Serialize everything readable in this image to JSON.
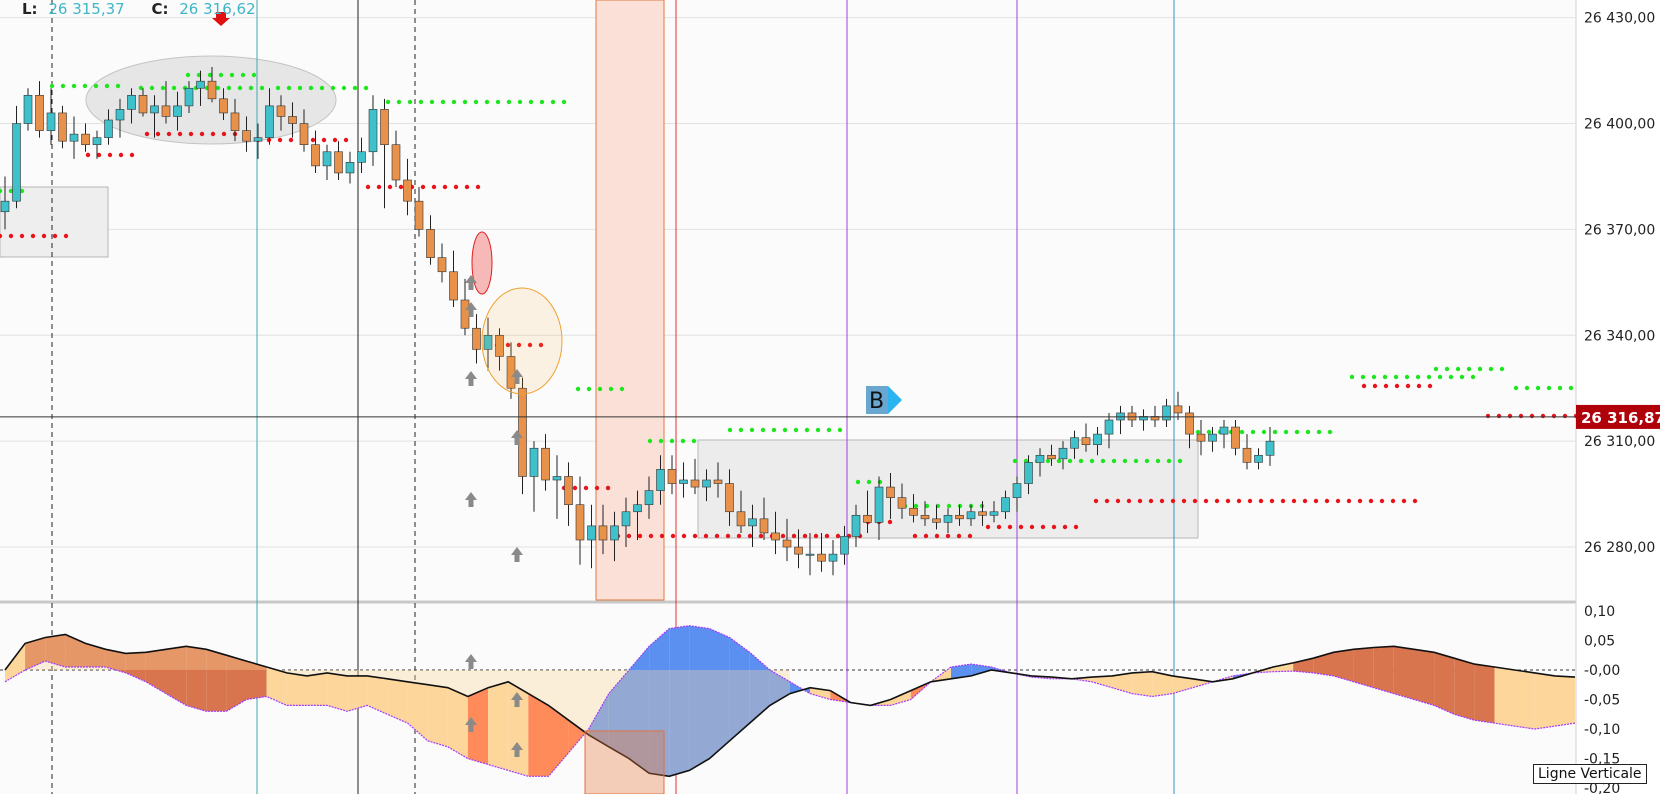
{
  "header": {
    "low_label": "L:",
    "low_value": "26 315,37",
    "close_label": "C:",
    "close_value": "26 316,62"
  },
  "price_axis": {
    "ticks": [
      "26 430,00",
      "26 400,00",
      "26 370,00",
      "26 340,00",
      "26 310,00",
      "26 280,00"
    ],
    "current_price": "26 316,87"
  },
  "oscillator_axis": {
    "ticks": [
      "0,10",
      "0,05",
      "-0,00",
      "-0,05",
      "-0,10",
      "-0,15",
      "-0,20"
    ]
  },
  "marker_label": "B",
  "vertical_line_label": "Ligne Verticale",
  "colors": {
    "bull_body": "#3fc1cc",
    "bear_body": "#e8914a",
    "support_dots": "#e8141a",
    "resistance_dots": "#1ee61e",
    "price_tag": "#b0000a",
    "osc_up_fill": "#d9754e",
    "osc_down_fill": "#ff8a5a",
    "osc_neutral_fill": "#fcd69a",
    "osc_blue_fill": "#5b8ff0"
  },
  "chart_data": [
    {
      "type": "candlestick",
      "ylim": [
        26265,
        26435
      ],
      "candles": [
        [
          26375,
          26385,
          26370,
          26378
        ],
        [
          26378,
          26405,
          26376,
          26400
        ],
        [
          26400,
          26410,
          26398,
          26408
        ],
        [
          26408,
          26412,
          26396,
          26398
        ],
        [
          26398,
          26410,
          26394,
          26403
        ],
        [
          26403,
          26405,
          26393,
          26395
        ],
        [
          26395,
          26402,
          26390,
          26397
        ],
        [
          26397,
          26400,
          26392,
          26394
        ],
        [
          26394,
          26398,
          26390,
          26396
        ],
        [
          26396,
          26404,
          26394,
          26401
        ],
        [
          26401,
          26407,
          26396,
          26404
        ],
        [
          26404,
          26410,
          26400,
          26408
        ],
        [
          26408,
          26410,
          26402,
          26403
        ],
        [
          26403,
          26408,
          26396,
          26405
        ],
        [
          26405,
          26412,
          26400,
          26402
        ],
        [
          26402,
          26409,
          26398,
          26405
        ],
        [
          26405,
          26412,
          26403,
          26410
        ],
        [
          26410,
          26415,
          26405,
          26412
        ],
        [
          26412,
          26416,
          26406,
          26407
        ],
        [
          26407,
          26410,
          26401,
          26403
        ],
        [
          26403,
          26407,
          26395,
          26398
        ],
        [
          26398,
          26402,
          26392,
          26395
        ],
        [
          26395,
          26400,
          26390,
          26396
        ],
        [
          26396,
          26410,
          26394,
          26405
        ],
        [
          26405,
          26408,
          26398,
          26402
        ],
        [
          26402,
          26406,
          26396,
          26400
        ],
        [
          26400,
          26404,
          26392,
          26394
        ],
        [
          26394,
          26398,
          26386,
          26388
        ],
        [
          26388,
          26394,
          26384,
          26392
        ],
        [
          26392,
          26395,
          26384,
          26386
        ],
        [
          26386,
          26392,
          26383,
          26389
        ],
        [
          26389,
          26396,
          26386,
          26392
        ],
        [
          26392,
          26408,
          26388,
          26404
        ],
        [
          26404,
          26407,
          26376,
          26394
        ],
        [
          26394,
          26398,
          26382,
          26384
        ],
        [
          26384,
          26390,
          26374,
          26378
        ],
        [
          26378,
          26382,
          26368,
          26370
        ],
        [
          26370,
          26374,
          26360,
          26362
        ],
        [
          26362,
          26366,
          26355,
          26358
        ],
        [
          26358,
          26364,
          26348,
          26350
        ],
        [
          26350,
          26356,
          26340,
          26342
        ],
        [
          26342,
          26346,
          26332,
          26336
        ],
        [
          26336,
          26345,
          26330,
          26340
        ],
        [
          26340,
          26342,
          26330,
          26334
        ],
        [
          26334,
          26338,
          26322,
          26325
        ],
        [
          26325,
          26328,
          26295,
          26300
        ],
        [
          26300,
          26310,
          26290,
          26308
        ],
        [
          26308,
          26312,
          26296,
          26299
        ],
        [
          26299,
          26306,
          26288,
          26300
        ],
        [
          26300,
          26304,
          26286,
          26292
        ],
        [
          26292,
          26300,
          26275,
          26282
        ],
        [
          26282,
          26292,
          26274,
          26286
        ],
        [
          26286,
          26292,
          26278,
          26282
        ],
        [
          26282,
          26290,
          26276,
          26286
        ],
        [
          26286,
          26294,
          26280,
          26290
        ],
        [
          26290,
          26296,
          26282,
          26292
        ],
        [
          26292,
          26300,
          26288,
          26296
        ],
        [
          26296,
          26306,
          26292,
          26302
        ],
        [
          26302,
          26306,
          26295,
          26298
        ],
        [
          26298,
          26304,
          26294,
          26299
        ],
        [
          26299,
          26305,
          26295,
          26297
        ],
        [
          26297,
          26302,
          26293,
          26299
        ],
        [
          26299,
          26304,
          26294,
          26298
        ],
        [
          26298,
          26302,
          26286,
          26290
        ],
        [
          26290,
          26296,
          26284,
          26286
        ],
        [
          26286,
          26292,
          26280,
          26288
        ],
        [
          26288,
          26294,
          26282,
          26284
        ],
        [
          26284,
          26290,
          26278,
          26282
        ],
        [
          26282,
          26288,
          26276,
          26280
        ],
        [
          26280,
          26285,
          26274,
          26278
        ],
        [
          26278,
          26284,
          26272,
          26278
        ],
        [
          26278,
          26284,
          26273,
          26276
        ],
        [
          26276,
          26282,
          26272,
          26278
        ],
        [
          26278,
          26286,
          26275,
          26283
        ],
        [
          26283,
          26292,
          26280,
          26289
        ],
        [
          26289,
          26296,
          26284,
          26287
        ],
        [
          26287,
          26300,
          26282,
          26297
        ],
        [
          26297,
          26301,
          26288,
          26294
        ],
        [
          26294,
          26298,
          26288,
          26291
        ],
        [
          26291,
          26295,
          26287,
          26289
        ],
        [
          26289,
          26293,
          26286,
          26288
        ],
        [
          26288,
          26292,
          26285,
          26287
        ],
        [
          26287,
          26291,
          26284,
          26289
        ],
        [
          26289,
          26292,
          26286,
          26288
        ],
        [
          26288,
          26292,
          26286,
          26290
        ],
        [
          26290,
          26293,
          26286,
          26289
        ],
        [
          26289,
          26293,
          26287,
          26290
        ],
        [
          26290,
          26296,
          26288,
          26294
        ],
        [
          26294,
          26300,
          26290,
          26298
        ],
        [
          26298,
          26306,
          26295,
          26304
        ],
        [
          26304,
          26308,
          26300,
          26306
        ],
        [
          26306,
          26309,
          26303,
          26305
        ],
        [
          26305,
          26310,
          26302,
          26308
        ],
        [
          26308,
          26313,
          26305,
          26311
        ],
        [
          26311,
          26315,
          26307,
          26309
        ],
        [
          26309,
          26314,
          26306,
          26312
        ],
        [
          26312,
          26318,
          26308,
          26316
        ],
        [
          26316,
          26320,
          26312,
          26318
        ],
        [
          26318,
          26320,
          26314,
          26316
        ],
        [
          26316,
          26319,
          26313,
          26317
        ],
        [
          26317,
          26320,
          26314,
          26316
        ],
        [
          26316,
          26322,
          26314,
          26320
        ],
        [
          26320,
          26324,
          26316,
          26318
        ],
        [
          26318,
          26320,
          26308,
          26312
        ],
        [
          26312,
          26316,
          26306,
          26310
        ],
        [
          26310,
          26314,
          26307,
          26312
        ],
        [
          26312,
          26316,
          26308,
          26314
        ],
        [
          26314,
          26316,
          26306,
          26308
        ],
        [
          26308,
          26312,
          26302,
          26304
        ],
        [
          26304,
          26308,
          26302,
          26306
        ],
        [
          26306,
          26314,
          26303,
          26310
        ]
      ]
    },
    {
      "type": "area",
      "ylim": [
        -0.21,
        0.11
      ],
      "series": [
        {
          "values": [
            0.0,
            0.045,
            0.055,
            0.06,
            0.045,
            0.035,
            0.028,
            0.03,
            0.035,
            0.04,
            0.035,
            0.025,
            0.015,
            0.005,
            -0.005,
            -0.01,
            -0.005,
            -0.01,
            -0.01,
            -0.015,
            -0.02,
            -0.025,
            -0.03,
            -0.045,
            -0.03,
            -0.02,
            -0.04,
            -0.06,
            -0.085,
            -0.11,
            -0.13,
            -0.15,
            -0.175,
            -0.18,
            -0.17,
            -0.15,
            -0.12,
            -0.09,
            -0.06,
            -0.04,
            -0.03,
            -0.035,
            -0.055,
            -0.06,
            -0.05,
            -0.035,
            -0.02,
            -0.015,
            -0.01,
            0.0,
            -0.005,
            -0.01,
            -0.012,
            -0.015,
            -0.012,
            -0.01,
            -0.005,
            -0.003,
            -0.01,
            -0.015,
            -0.02,
            -0.015,
            -0.005,
            0.005,
            0.012,
            0.02,
            0.03,
            0.035,
            0.038,
            0.04,
            0.035,
            0.03,
            0.02,
            0.01,
            0.005,
            0.0,
            -0.005,
            -0.01,
            -0.012
          ]
        },
        {
          "values": [
            -0.02,
            0.0,
            0.015,
            0.005,
            0.005,
            0.005,
            -0.005,
            -0.02,
            -0.04,
            -0.06,
            -0.07,
            -0.07,
            -0.05,
            -0.045,
            -0.06,
            -0.06,
            -0.06,
            -0.07,
            -0.06,
            -0.075,
            -0.09,
            -0.12,
            -0.13,
            -0.15,
            -0.16,
            -0.17,
            -0.18,
            -0.18,
            -0.14,
            -0.1,
            -0.04,
            0.0,
            0.04,
            0.07,
            0.075,
            0.07,
            0.055,
            0.03,
            0.0,
            -0.02,
            -0.04,
            -0.05,
            -0.055,
            -0.06,
            -0.06,
            -0.05,
            -0.02,
            0.005,
            0.01,
            0.005,
            -0.005,
            -0.012,
            -0.015,
            -0.015,
            -0.02,
            -0.03,
            -0.04,
            -0.045,
            -0.04,
            -0.03,
            -0.02,
            -0.01,
            -0.005,
            -0.003,
            -0.002,
            -0.005,
            -0.01,
            -0.02,
            -0.03,
            -0.04,
            -0.05,
            -0.06,
            -0.075,
            -0.085,
            -0.09,
            -0.095,
            -0.1,
            -0.095,
            -0.09
          ]
        }
      ]
    }
  ]
}
